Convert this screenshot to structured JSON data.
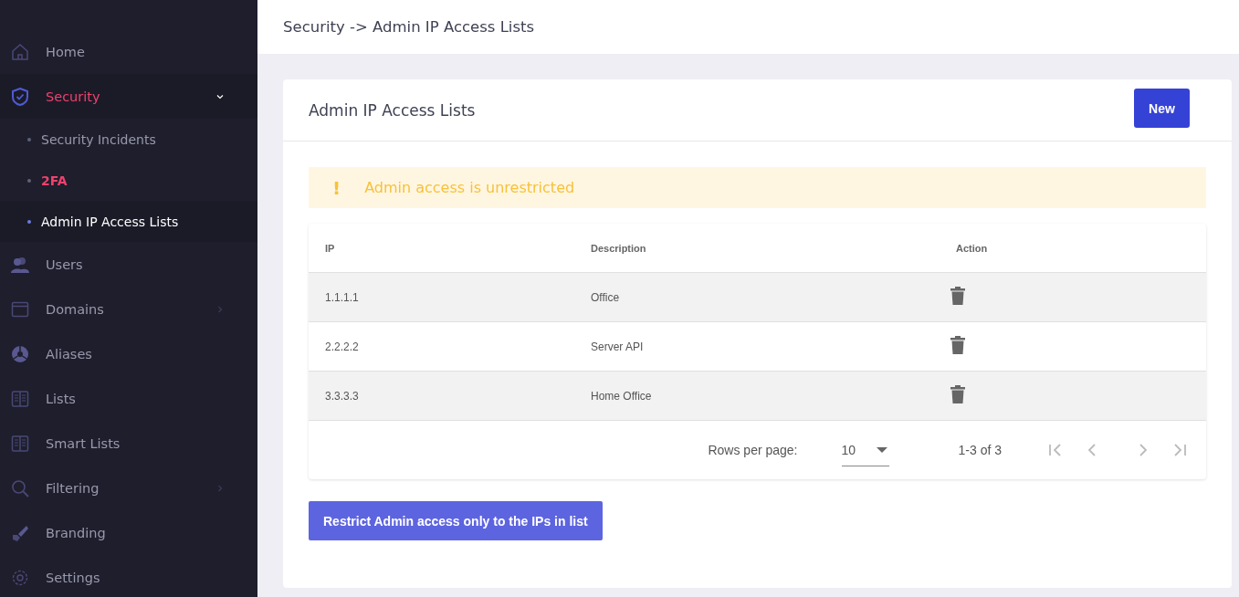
{
  "sidebar": {
    "items": [
      {
        "label": "Home",
        "active": false,
        "expanded": false,
        "has_submenu": false
      },
      {
        "label": "Security",
        "active": true,
        "expanded": true,
        "has_submenu": true,
        "children": [
          {
            "label": "Security Incidents",
            "selected": false,
            "highlighted": false
          },
          {
            "label": "2FA",
            "selected": false,
            "highlighted": true
          },
          {
            "label": "Admin IP Access Lists",
            "selected": true,
            "highlighted": false
          }
        ]
      },
      {
        "label": "Users",
        "active": false,
        "expanded": false,
        "has_submenu": false
      },
      {
        "label": "Domains",
        "active": false,
        "expanded": false,
        "has_submenu": true
      },
      {
        "label": "Aliases",
        "active": false,
        "expanded": false,
        "has_submenu": false
      },
      {
        "label": "Lists",
        "active": false,
        "expanded": false,
        "has_submenu": false
      },
      {
        "label": "Smart Lists",
        "active": false,
        "expanded": false,
        "has_submenu": false
      },
      {
        "label": "Filtering",
        "active": false,
        "expanded": false,
        "has_submenu": true
      },
      {
        "label": "Branding",
        "active": false,
        "expanded": false,
        "has_submenu": false
      },
      {
        "label": "Settings",
        "active": false,
        "expanded": false,
        "has_submenu": false
      }
    ]
  },
  "header": {
    "breadcrumb": "Security -> Admin IP Access Lists"
  },
  "card": {
    "title": "Admin IP Access Lists",
    "new_button": "New",
    "alert": {
      "icon": "!",
      "message": "Admin access is unrestricted"
    },
    "table": {
      "columns": [
        "IP",
        "Description",
        "Action"
      ],
      "rows": [
        {
          "ip": "1.1.1.1",
          "description": "Office"
        },
        {
          "ip": "2.2.2.2",
          "description": "Server API"
        },
        {
          "ip": "3.3.3.3",
          "description": "Home Office"
        }
      ]
    },
    "pagination": {
      "rows_per_page_label": "Rows per page:",
      "rows_per_page": "10",
      "range": "1-3 of 3"
    },
    "restrict_button": "Restrict Admin access only to the IPs in list"
  }
}
